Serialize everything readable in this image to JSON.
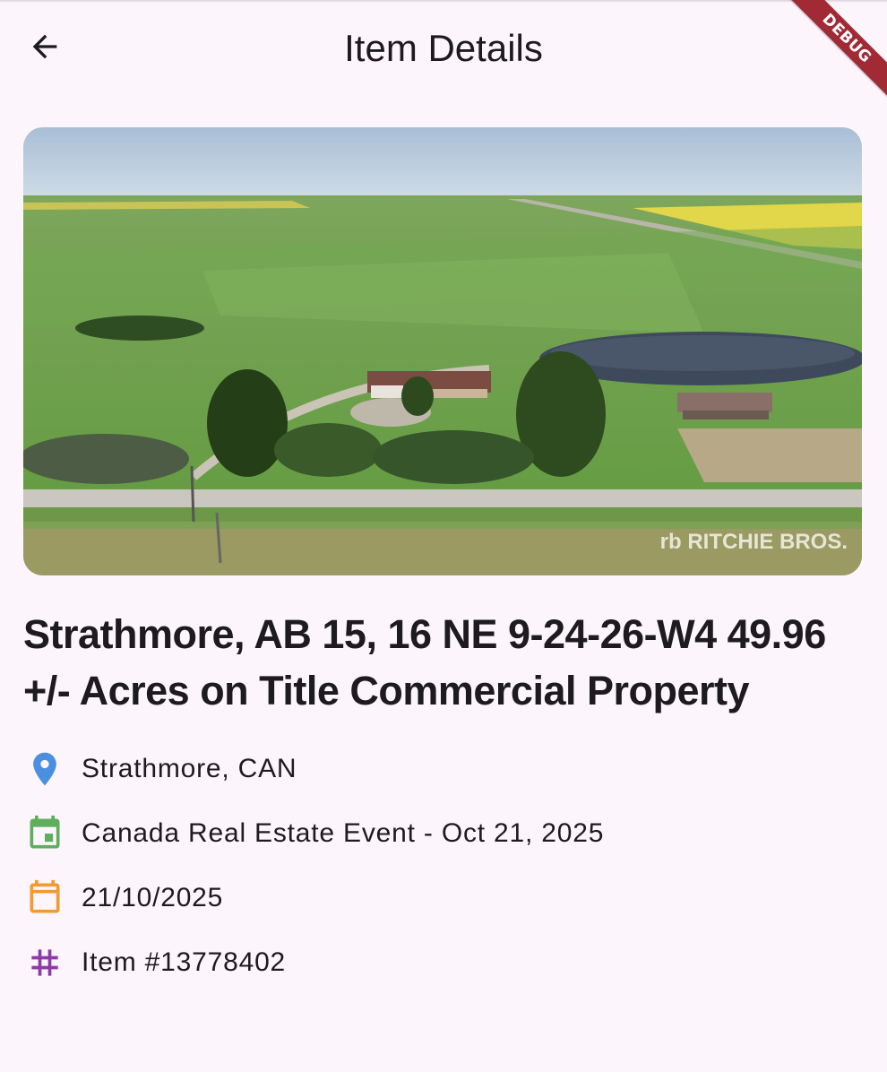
{
  "app_bar": {
    "title": "Item Details",
    "debug_label": "DEBUG"
  },
  "hero": {
    "watermark": "rb RITCHIE BROS."
  },
  "item": {
    "title": "Strathmore, AB 15, 16 NE 9-24-26-W4 49.96 +/- Acres on Title Commercial Property",
    "details": [
      {
        "icon": "location-pin-icon",
        "color": "#4a8fe0",
        "text": "Strathmore, CAN"
      },
      {
        "icon": "event-calendar-icon",
        "color": "#5fae5d",
        "text": "Canada Real Estate Event - Oct 21, 2025"
      },
      {
        "icon": "calendar-icon",
        "color": "#f09a30",
        "text": "21/10/2025"
      },
      {
        "icon": "hash-icon",
        "color": "#8e3aa8",
        "text": "Item #13778402"
      }
    ]
  },
  "colors": {
    "background": "#fcf5fc",
    "text": "#1d1b20",
    "debug_banner": "#a12a35"
  }
}
